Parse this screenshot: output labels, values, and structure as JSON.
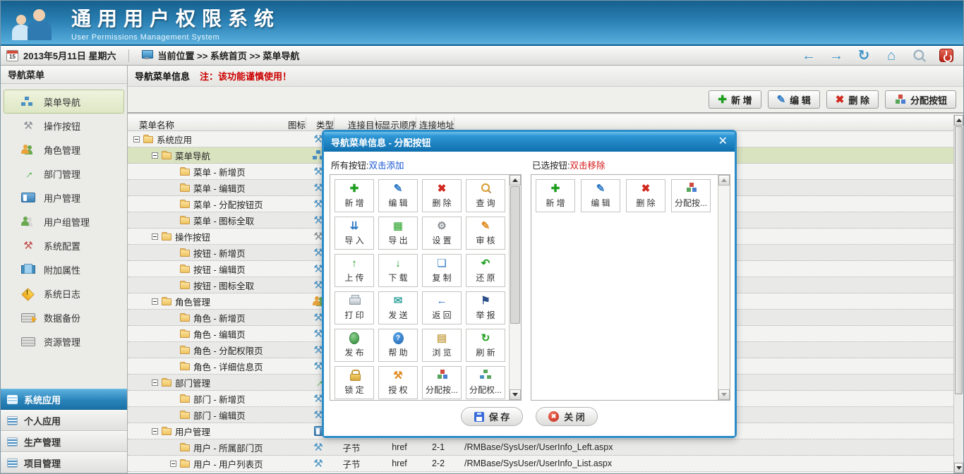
{
  "app": {
    "title": "通用用户权限系统",
    "subtitle": "User Permissions Management System"
  },
  "topbar": {
    "calendar_day": "15",
    "date": "2013年5月11日 星期六",
    "breadcrumb": "当前位置 >> 系统首页 >> 菜单导航",
    "nav_icons": [
      {
        "name": "back-icon"
      },
      {
        "name": "forward-icon"
      },
      {
        "name": "nav-refresh-icon"
      },
      {
        "name": "home-icon"
      },
      {
        "name": "nav-search-icon"
      },
      {
        "name": "power-icon"
      }
    ]
  },
  "sidebar": {
    "title": "导航菜单",
    "items": [
      {
        "label": "菜单导航",
        "icon": "sitemap-icon",
        "selected": true
      },
      {
        "label": "操作按钮",
        "icon": "wrench-icon"
      },
      {
        "label": "角色管理",
        "icon": "users-icon"
      },
      {
        "label": "部门管理",
        "icon": "dept-arrow-icon"
      },
      {
        "label": "用户管理",
        "icon": "notebook-icon"
      },
      {
        "label": "用户组管理",
        "icon": "user-group-icon"
      },
      {
        "label": "系统配置",
        "icon": "tools-icon"
      },
      {
        "label": "附加属性",
        "icon": "books-icon"
      },
      {
        "label": "系统日志",
        "icon": "warning-icon"
      },
      {
        "label": "数据备份",
        "icon": "backup-icon"
      },
      {
        "label": "资源管理",
        "icon": "server-icon"
      }
    ],
    "accordion": [
      {
        "label": "系统应用",
        "icon": "list-icon",
        "selected": true
      },
      {
        "label": "个人应用",
        "icon": "list-icon"
      },
      {
        "label": "生产管理",
        "icon": "list-icon"
      },
      {
        "label": "项目管理",
        "icon": "list-icon"
      }
    ]
  },
  "content": {
    "header_title": "导航菜单信息",
    "header_note": "注：该功能谨慎使用！",
    "toolbar": [
      {
        "label": "新 增",
        "icon": "plus-icon"
      },
      {
        "label": "编 辑",
        "icon": "pencil-icon"
      },
      {
        "label": "删 除",
        "icon": "delete-icon"
      },
      {
        "label": "分配按钮",
        "icon": "cubes-icon"
      }
    ],
    "table": {
      "columns": [
        "菜单名称",
        "图标",
        "类型",
        "连接目标",
        "显示顺序",
        "连接地址"
      ],
      "rows": [
        {
          "label": "系统应用",
          "level": 0,
          "expander": true,
          "row_icon": "hammer-icon",
          "type": "",
          "target": "",
          "order": "",
          "url": ""
        },
        {
          "label": "菜单导航",
          "level": 1,
          "expander": true,
          "row_icon": "sitemap-icon",
          "selected": true,
          "type": "",
          "target": "",
          "order": "",
          "url": ""
        },
        {
          "label": "菜单 - 新增页",
          "level": 2,
          "expander": false,
          "row_icon": "hammer-icon",
          "type": "",
          "target": "",
          "order": "",
          "url": ""
        },
        {
          "label": "菜单 - 编辑页",
          "level": 2,
          "expander": false,
          "row_icon": "hammer-icon",
          "type": "",
          "target": "",
          "order": "",
          "url": ""
        },
        {
          "label": "菜单 - 分配按钮页",
          "level": 2,
          "expander": false,
          "row_icon": "hammer-icon",
          "type": "",
          "target": "",
          "order": "",
          "url": ""
        },
        {
          "label": "菜单 - 图标全取",
          "level": 2,
          "expander": false,
          "row_icon": "hammer-icon",
          "type": "",
          "target": "",
          "order": "",
          "url": ""
        },
        {
          "label": "操作按钮",
          "level": 1,
          "expander": true,
          "row_icon": "wrench-icon",
          "type": "",
          "target": "",
          "order": "",
          "url": ""
        },
        {
          "label": "按钮 - 新增页",
          "level": 2,
          "expander": false,
          "row_icon": "hammer-icon",
          "type": "",
          "target": "",
          "order": "",
          "url": ""
        },
        {
          "label": "按钮 - 编辑页",
          "level": 2,
          "expander": false,
          "row_icon": "hammer-icon",
          "type": "",
          "target": "",
          "order": "",
          "url": ""
        },
        {
          "label": "按钮 - 图标全取",
          "level": 2,
          "expander": false,
          "row_icon": "hammer-icon",
          "type": "",
          "target": "",
          "order": "",
          "url": ""
        },
        {
          "label": "角色管理",
          "level": 1,
          "expander": true,
          "row_icon": "users-icon",
          "type": "",
          "target": "",
          "order": "",
          "url": ""
        },
        {
          "label": "角色 - 新增页",
          "level": 2,
          "expander": false,
          "row_icon": "hammer-icon",
          "type": "",
          "target": "",
          "order": "",
          "url": ""
        },
        {
          "label": "角色 - 编辑页",
          "level": 2,
          "expander": false,
          "row_icon": "hammer-icon",
          "type": "",
          "target": "",
          "order": "",
          "url": ""
        },
        {
          "label": "角色 - 分配权限页",
          "level": 2,
          "expander": false,
          "row_icon": "hammer-icon",
          "type": "",
          "target": "",
          "order": "",
          "url": ""
        },
        {
          "label": "角色 - 详细信息页",
          "level": 2,
          "expander": false,
          "row_icon": "hammer-icon",
          "type": "",
          "target": "",
          "order": "",
          "url": ""
        },
        {
          "label": "部门管理",
          "level": 1,
          "expander": true,
          "row_icon": "dept-arrow-icon",
          "type": "",
          "target": "",
          "order": "",
          "url": ""
        },
        {
          "label": "部门 - 新增页",
          "level": 2,
          "expander": false,
          "row_icon": "hammer-icon",
          "type": "",
          "target": "",
          "order": "",
          "url": ""
        },
        {
          "label": "部门 - 编辑页",
          "level": 2,
          "expander": false,
          "row_icon": "hammer-icon",
          "type": "",
          "target": "",
          "order": "",
          "url": ""
        },
        {
          "label": "用户管理",
          "level": 1,
          "expander": true,
          "row_icon": "notebook-icon",
          "type": "",
          "target": "",
          "order": "",
          "url": ""
        },
        {
          "label": "用户 - 所属部门页",
          "level": 2,
          "expander": false,
          "row_icon": "hammer-icon",
          "type": "子节",
          "target": "href",
          "order": "2-1",
          "url": "/RMBase/SysUser/UserInfo_Left.aspx"
        },
        {
          "label": "用户 - 用户列表页",
          "level": 2,
          "expander": true,
          "row_icon": "hammer-icon",
          "type": "子节",
          "target": "href",
          "order": "2-2",
          "url": "/RMBase/SysUser/UserInfo_List.aspx"
        }
      ]
    }
  },
  "modal": {
    "title": "导航菜单信息 - 分配按钮",
    "close_glyph": "✕",
    "left_panel": {
      "label": "所有按钮:",
      "hint": "双击添加",
      "buttons": [
        {
          "label": "新 增",
          "icon": "plus-icon"
        },
        {
          "label": "编 辑",
          "icon": "pencil-icon"
        },
        {
          "label": "删 除",
          "icon": "delete-icon"
        },
        {
          "label": "查 询",
          "icon": "search-icon"
        },
        {
          "label": "导 入",
          "icon": "import-icon"
        },
        {
          "label": "导 出",
          "icon": "export-icon"
        },
        {
          "label": "设 置",
          "icon": "settings-icon"
        },
        {
          "label": "审 核",
          "icon": "audit-icon"
        },
        {
          "label": "上 传",
          "icon": "upload-icon"
        },
        {
          "label": "下 载",
          "icon": "download-icon"
        },
        {
          "label": "复 制",
          "icon": "copy-icon"
        },
        {
          "label": "还 原",
          "icon": "restore-icon"
        },
        {
          "label": "打 印",
          "icon": "print-icon"
        },
        {
          "label": "发 送",
          "icon": "send-icon"
        },
        {
          "label": "返 回",
          "icon": "return-icon"
        },
        {
          "label": "举 报",
          "icon": "report-icon"
        },
        {
          "label": "发 布",
          "icon": "publish-icon"
        },
        {
          "label": "帮 助",
          "icon": "help-icon"
        },
        {
          "label": "浏 览",
          "icon": "browse-icon"
        },
        {
          "label": "刷 新",
          "icon": "refresh-icon"
        },
        {
          "label": "锁 定",
          "icon": "lock-icon"
        },
        {
          "label": "授 权",
          "icon": "authorize-icon"
        },
        {
          "label": "分配按...",
          "icon": "cubes-icon"
        },
        {
          "label": "分配权...",
          "icon": "sitemap-plus-icon"
        }
      ]
    },
    "right_panel": {
      "label": "已选按钮:",
      "hint": "双击移除",
      "buttons": [
        {
          "label": "新 增",
          "icon": "plus-icon"
        },
        {
          "label": "编 辑",
          "icon": "pencil-icon"
        },
        {
          "label": "删 除",
          "icon": "delete-icon"
        },
        {
          "label": "分配按...",
          "icon": "cubes-icon"
        }
      ]
    },
    "footer": [
      {
        "label": "保 存",
        "icon": "floppy-icon"
      },
      {
        "label": "关 闭",
        "icon": "close-circle-icon"
      }
    ]
  }
}
